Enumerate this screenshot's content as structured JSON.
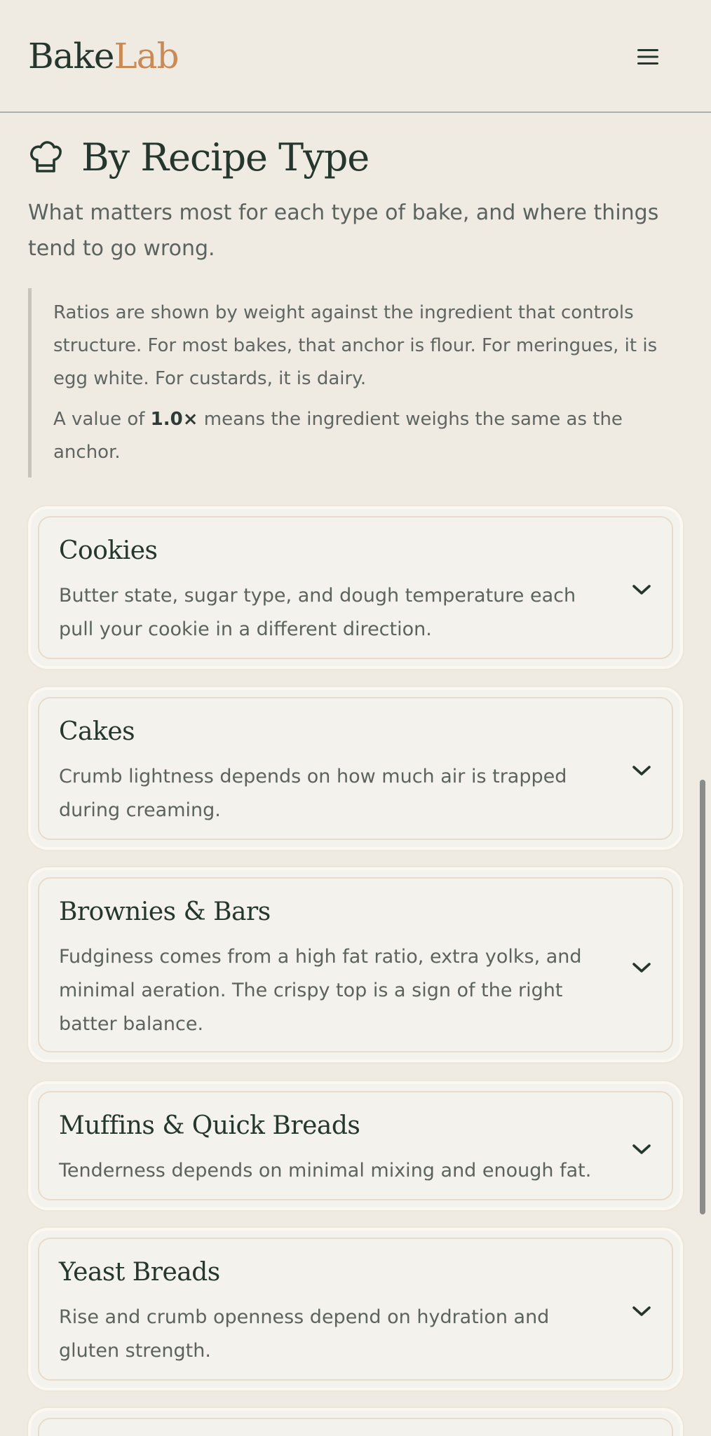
{
  "header": {
    "logo_part1": "Bake",
    "logo_part2": "Lab",
    "menu_icon": "hamburger-menu-icon"
  },
  "section": {
    "icon": "chef-hat-icon",
    "title": "By Recipe Type",
    "subtitle": "What matters most for each type of bake, and where things tend to go wrong."
  },
  "note": {
    "paragraph1": "Ratios are shown by weight against the ingredient that controls structure. For most bakes, that anchor is flour. For meringues, it is egg white. For custards, it is dairy.",
    "paragraph2_prefix": "A value of ",
    "paragraph2_value": "1.0×",
    "paragraph2_suffix": " means the ingredient weighs the same as the anchor."
  },
  "cards": [
    {
      "title": "Cookies",
      "description": "Butter state, sugar type, and dough temperature each pull your cookie in a different direction.",
      "icon": "chevron-down-icon"
    },
    {
      "title": "Cakes",
      "description": "Crumb lightness depends on how much air is trapped during creaming.",
      "icon": "chevron-down-icon"
    },
    {
      "title": "Brownies & Bars",
      "description": "Fudginess comes from a high fat ratio, extra yolks, and minimal aeration. The crispy top is a sign of the right batter balance.",
      "icon": "chevron-down-icon"
    },
    {
      "title": "Muffins & Quick Breads",
      "description": "Tenderness depends on minimal mixing and enough fat.",
      "icon": "chevron-down-icon"
    },
    {
      "title": "Yeast Breads",
      "description": "Rise and crumb openness depend on hydration and gluten strength.",
      "icon": "chevron-down-icon"
    }
  ],
  "colors": {
    "background": "#efebe3",
    "card_background": "#f4f2ed",
    "heading": "#25372c",
    "accent": "#c98a55",
    "body_text": "#5c635e"
  }
}
